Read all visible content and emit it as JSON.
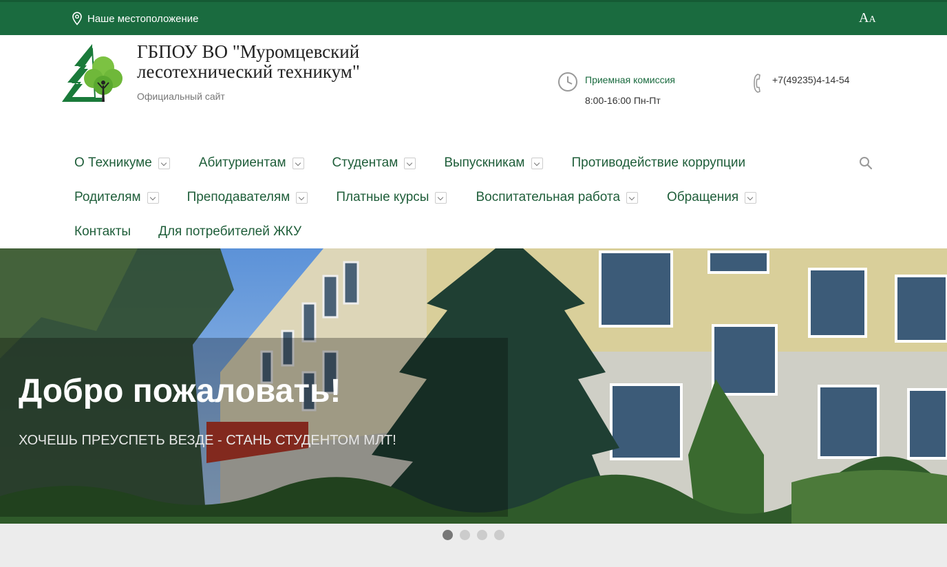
{
  "topbar": {
    "location_label": "Наше местоположение",
    "font_size_big": "A",
    "font_size_small": "A"
  },
  "header": {
    "title": "ГБПОУ ВО \"Муромцевский лесотехнический техникум\"",
    "subtitle": "Официальный сайт",
    "hours_label": "Приемная комиссия",
    "hours_value": "8:00-16:00 Пн-Пт",
    "phone": "+7(49235)4-14-54"
  },
  "nav": {
    "row1": [
      {
        "label": "О Техникуме",
        "dropdown": true
      },
      {
        "label": "Абитуриентам",
        "dropdown": true
      },
      {
        "label": "Студентам",
        "dropdown": true
      },
      {
        "label": "Выпускникам",
        "dropdown": true
      },
      {
        "label": "Противодействие коррупции",
        "dropdown": false
      }
    ],
    "row2": [
      {
        "label": "Родителям",
        "dropdown": true
      },
      {
        "label": "Преподавателям",
        "dropdown": true
      },
      {
        "label": "Платные курсы",
        "dropdown": true
      },
      {
        "label": "Воспитательная работа",
        "dropdown": true
      },
      {
        "label": "Обращения",
        "dropdown": true
      }
    ],
    "row3": [
      {
        "label": "Контакты",
        "dropdown": false
      },
      {
        "label": "Для потребителей ЖКУ",
        "dropdown": false
      }
    ]
  },
  "hero": {
    "title": "Добро пожаловать!",
    "subtitle": "ХОЧЕШЬ ПРЕУСПЕТЬ ВЕЗДЕ - СТАНЬ СТУДЕНТОМ МЛТ!"
  },
  "slider": {
    "slide_count": 4,
    "active_index": 0
  },
  "colors": {
    "brand_green": "#1a6b3f",
    "nav_text": "#1f5e3a"
  },
  "icons": [
    "location-pin-icon",
    "font-size-icon",
    "clock-icon",
    "phone-icon",
    "search-icon",
    "chevron-down-icon"
  ]
}
